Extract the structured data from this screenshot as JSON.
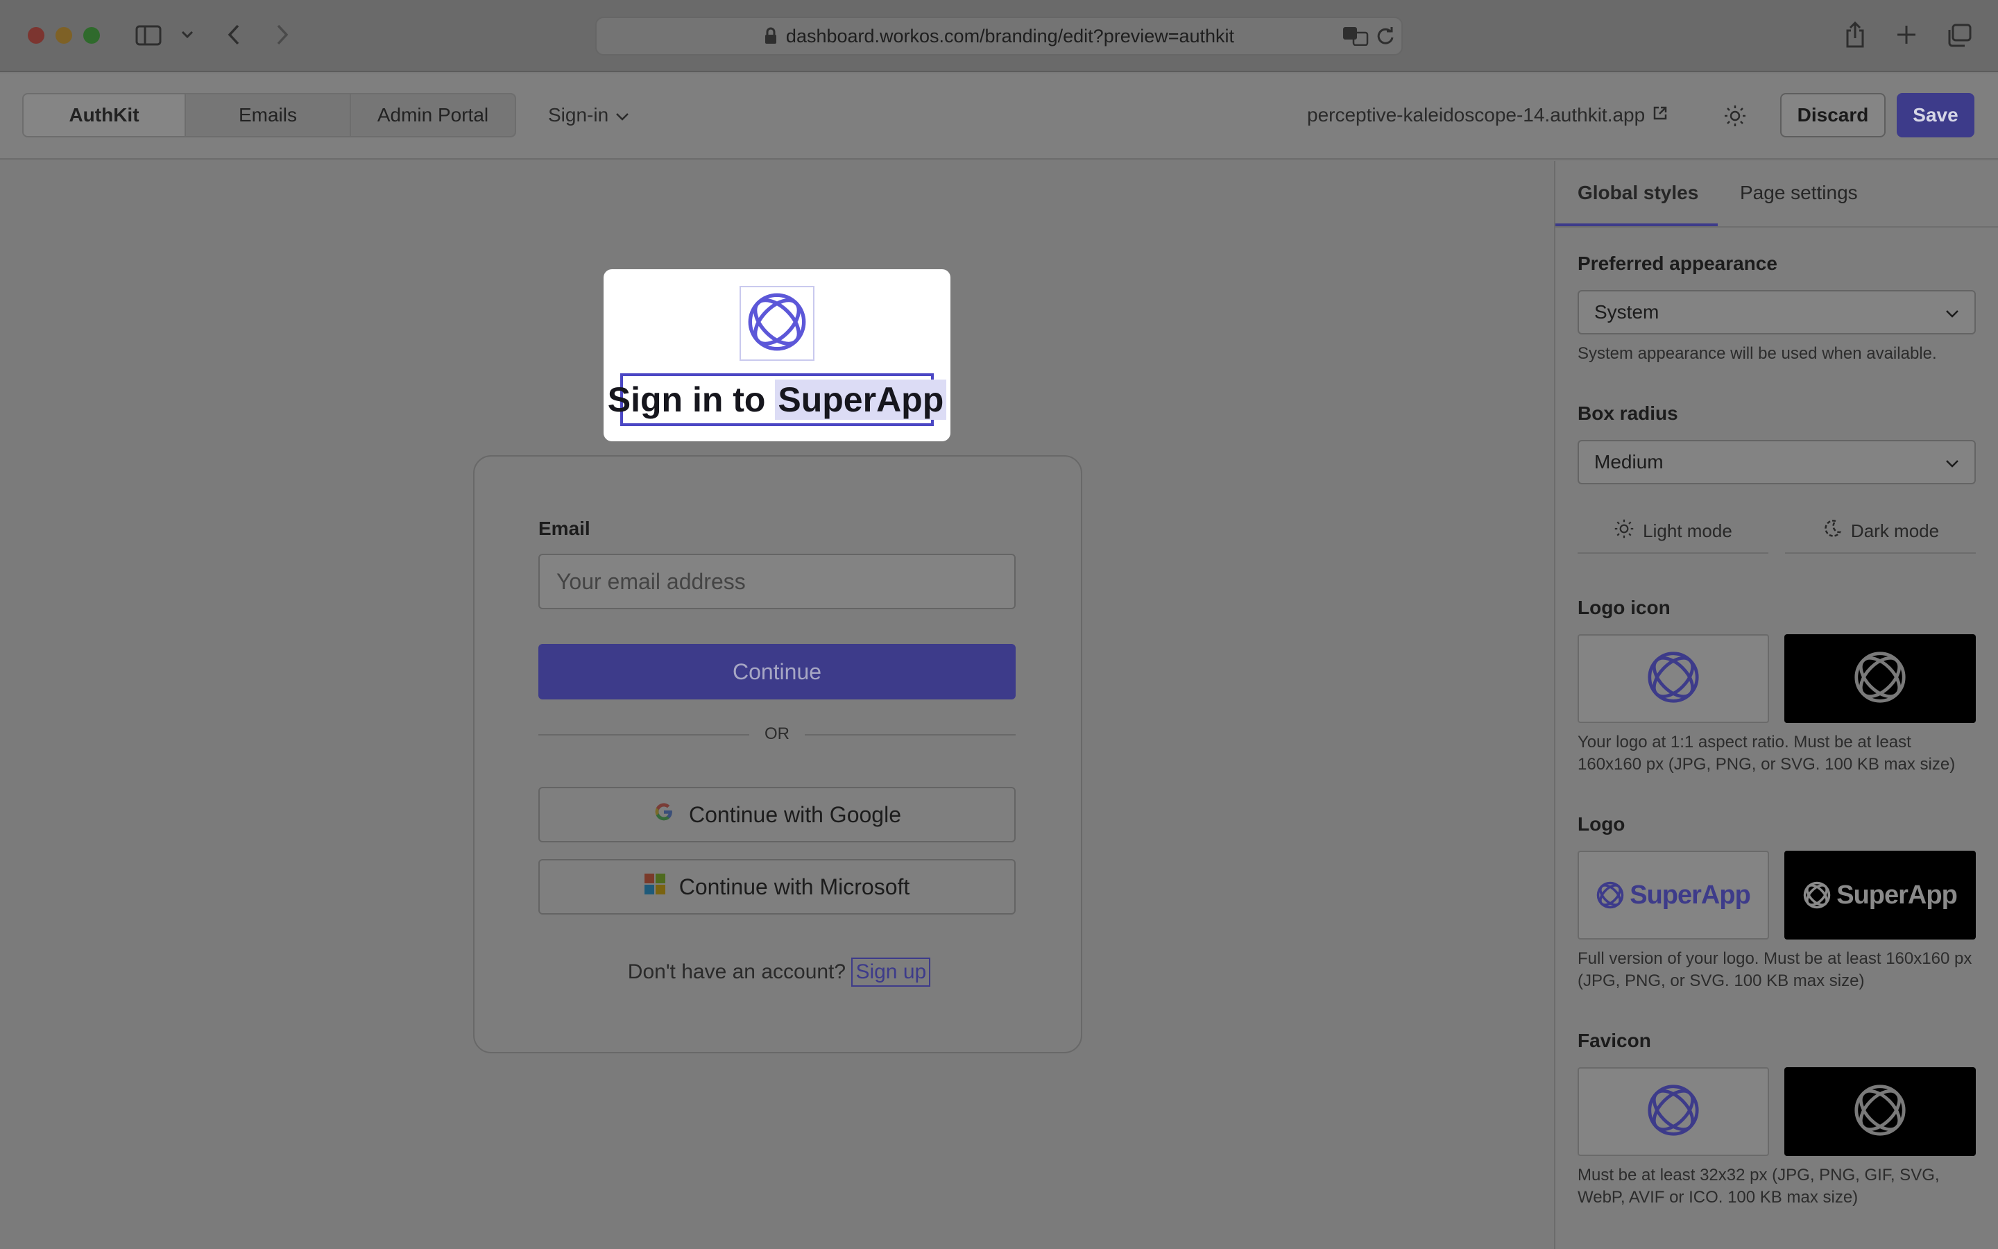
{
  "browser": {
    "url": "dashboard.workos.com/branding/edit?preview=authkit"
  },
  "toolbar": {
    "tabs": [
      {
        "label": "AuthKit"
      },
      {
        "label": "Emails"
      },
      {
        "label": "Admin Portal"
      }
    ],
    "page_select": "Sign-in",
    "domain": "perceptive-kaleidoscope-14.authkit.app",
    "discard_label": "Discard",
    "save_label": "Save"
  },
  "preview": {
    "title_prefix": "Sign in to",
    "app_name": "SuperApp",
    "email_label": "Email",
    "email_placeholder": "Your email address",
    "continue_label": "Continue",
    "or_label": "OR",
    "google_label": "Continue with Google",
    "microsoft_label": "Continue with Microsoft",
    "footer_text": "Don't have an account?",
    "signup_label": "Sign up"
  },
  "sidebar": {
    "tabs": [
      {
        "label": "Global styles"
      },
      {
        "label": "Page settings"
      }
    ],
    "appearance": {
      "label": "Preferred appearance",
      "value": "System",
      "hint": "System appearance will be used when available."
    },
    "radius": {
      "label": "Box radius",
      "value": "Medium"
    },
    "modes": [
      {
        "label": "Light mode"
      },
      {
        "label": "Dark mode"
      }
    ],
    "logo_icon": {
      "label": "Logo icon",
      "hint": "Your logo at 1:1 aspect ratio. Must be at least 160x160 px (JPG, PNG, or SVG. 100 KB max size)"
    },
    "logo": {
      "label": "Logo",
      "wordmark": "SuperApp",
      "hint": "Full version of your logo. Must be at least 160x160 px (JPG, PNG, or SVG. 100 KB max size)"
    },
    "favicon": {
      "label": "Favicon",
      "hint": "Must be at least 32x32 px (JPG, PNG, GIF, SVG, WebP, AVIF or ICO. 100 KB max size)"
    }
  },
  "colors": {
    "accent": "#3d3b8a",
    "brand_logo": "#5c57d8"
  }
}
